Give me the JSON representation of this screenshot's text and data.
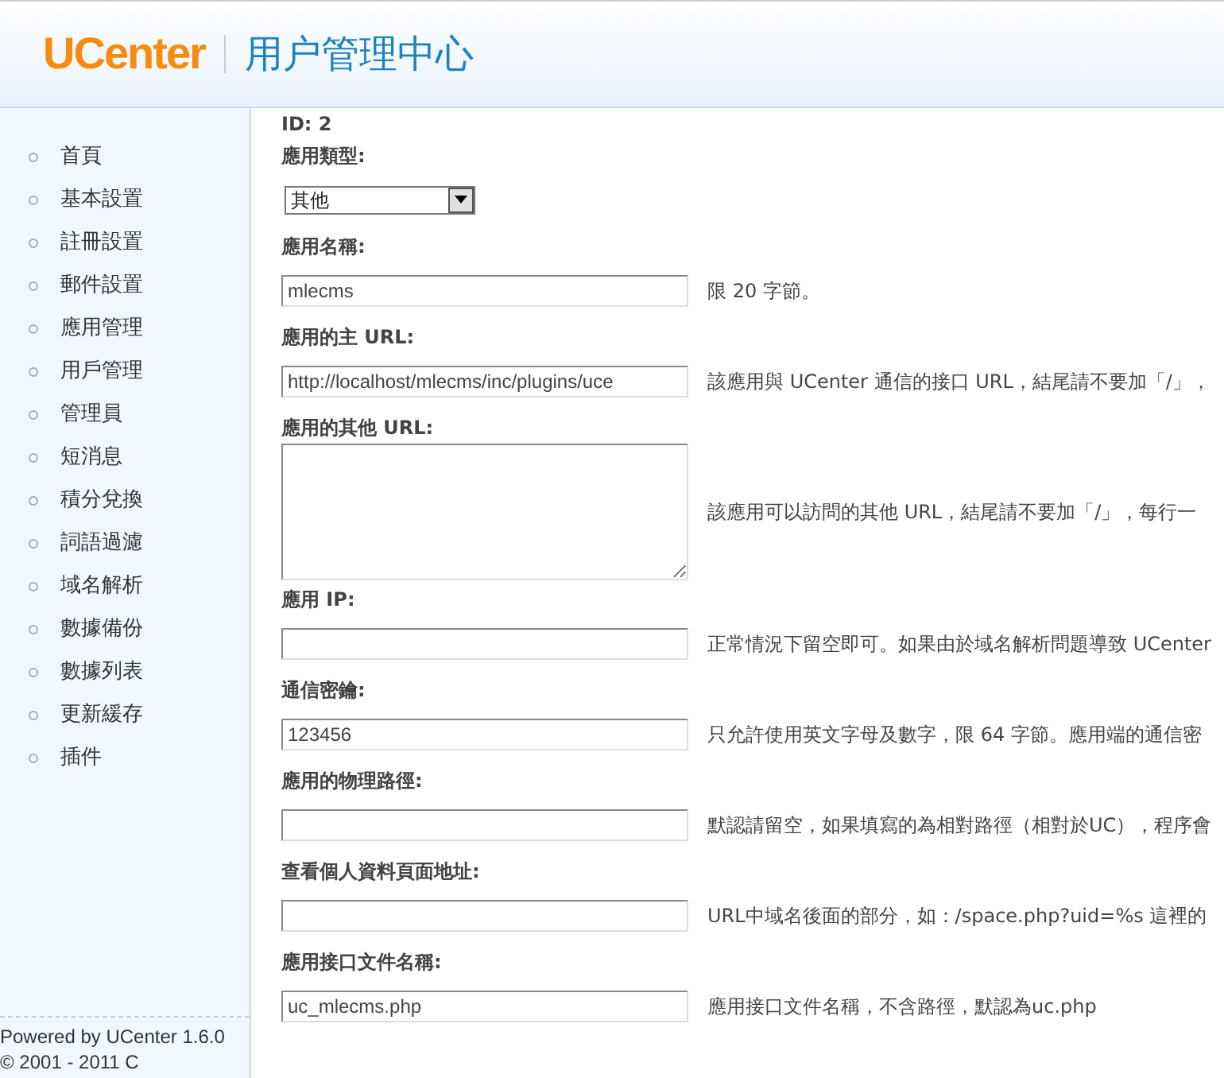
{
  "header": {
    "logo": "UCenter",
    "title": "用户管理中心"
  },
  "sidebar": {
    "items": [
      {
        "label": "首頁"
      },
      {
        "label": "基本設置"
      },
      {
        "label": "註冊設置"
      },
      {
        "label": "郵件設置"
      },
      {
        "label": "應用管理"
      },
      {
        "label": "用戶管理"
      },
      {
        "label": "管理員"
      },
      {
        "label": "短消息"
      },
      {
        "label": "積分兌換"
      },
      {
        "label": "詞語過濾"
      },
      {
        "label": "域名解析"
      },
      {
        "label": "數據備份"
      },
      {
        "label": "數據列表"
      },
      {
        "label": "更新緩存"
      },
      {
        "label": "插件"
      }
    ],
    "footer": [
      "Powered by UCenter 1.6.0",
      "© 2001 - 2011 C"
    ]
  },
  "form": {
    "id_line": "ID: 2",
    "fields": [
      {
        "kind": "select",
        "label": "應用類型:",
        "value": "其他"
      },
      {
        "kind": "text",
        "label": "應用名稱:",
        "value": "mlecms",
        "hint": "限 20 字節。"
      },
      {
        "kind": "text",
        "label": "應用的主 URL:",
        "value": "http://localhost/mlecms/inc/plugins/uce",
        "hint": "該應用與 UCenter 通信的接口 URL，結尾請不要加「/」，"
      },
      {
        "kind": "textarea",
        "label": "應用的其他 URL:",
        "hint": "該應用可以訪問的其他 URL，結尾請不要加「/」，每行一"
      },
      {
        "kind": "text",
        "label": "應用 IP:",
        "hint": "正常情況下留空即可。如果由於域名解析問題導致 UCenter"
      },
      {
        "kind": "text",
        "label": "通信密鑰:",
        "value": "123456",
        "hint": "只允許使用英文字母及數字，限 64 字節。應用端的通信密"
      },
      {
        "kind": "text",
        "label": "應用的物理路徑:",
        "hint": "默認請留空，如果填寫的為相對路徑（相對於UC），程序會"
      },
      {
        "kind": "text",
        "label": "查看個人資料頁面地址:",
        "hint": "URL中域名後面的部分，如：/space.php?uid=%s 這裡的"
      },
      {
        "kind": "text",
        "label": "應用接口文件名稱:",
        "value": "uc_mlecms.php",
        "hint": "應用接口文件名稱，不含路徑，默認為uc.php"
      }
    ]
  }
}
